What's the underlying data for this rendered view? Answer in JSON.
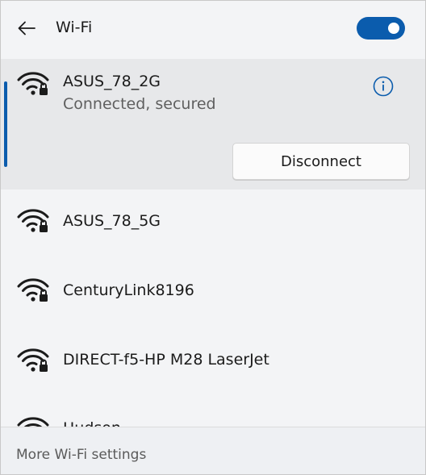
{
  "header": {
    "title": "Wi-Fi",
    "back_icon": "back-arrow-icon",
    "toggle_state": "on"
  },
  "networks": [
    {
      "name": "ASUS_78_2G",
      "status": "Connected, secured",
      "secured": true,
      "connected": true,
      "action_label": "Disconnect"
    },
    {
      "name": "ASUS_78_5G",
      "secured": true
    },
    {
      "name": "CenturyLink8196",
      "secured": true
    },
    {
      "name": "DIRECT-f5-HP M28 LaserJet",
      "secured": true
    },
    {
      "name": "Hudson",
      "secured": true
    }
  ],
  "footer": {
    "link_label": "More Wi-Fi settings"
  },
  "colors": {
    "accent": "#0b5cad",
    "panel_bg": "#f3f4f6",
    "selected_bg": "#e7e8ea"
  }
}
